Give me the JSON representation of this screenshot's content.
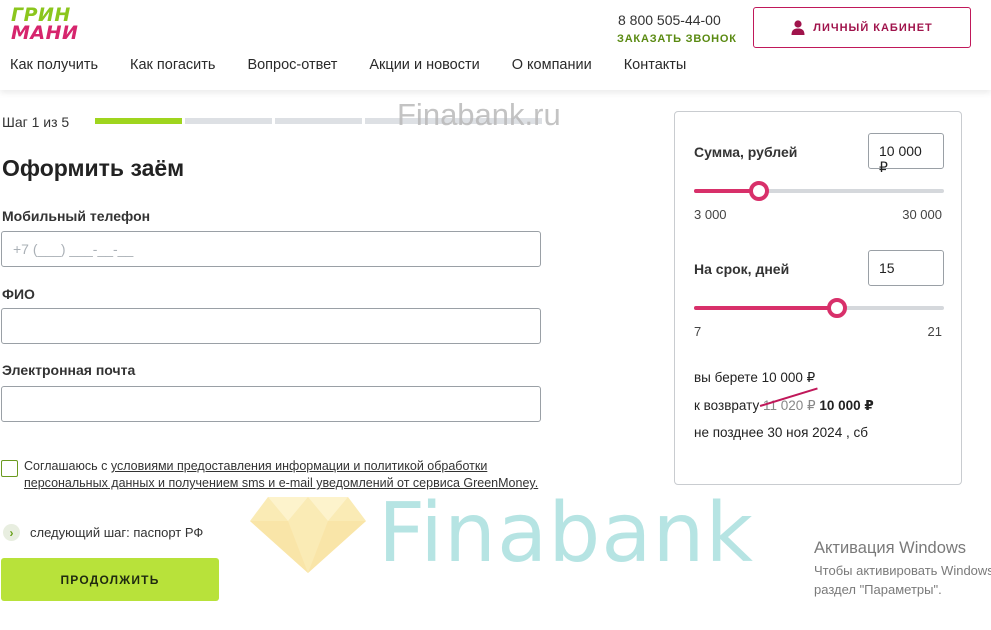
{
  "header": {
    "logo": {
      "line1": "ГРИН",
      "line2": "МАНИ",
      "color_green": "#8bc61d",
      "color_pink": "#d6256d"
    },
    "phone": "8 800 505-44-00",
    "callback_label": "ЗАКАЗАТЬ ЗВОНОК",
    "cabinet_label": "ЛИЧНЫЙ КАБИНЕТ",
    "cabinet_icon": "user-icon",
    "nav": [
      "Как получить",
      "Как погасить",
      "Вопрос-ответ",
      "Акции и новости",
      "О компании",
      "Контакты"
    ]
  },
  "steps": {
    "label": "Шаг 1 из 5",
    "current": 1,
    "total": 5,
    "accent": "#9fd51e"
  },
  "watermark": "Finabank.ru",
  "form": {
    "title": "Оформить заём",
    "phone": {
      "label": "Мобильный телефон",
      "placeholder": "+7 (___) ___-__-__",
      "value": ""
    },
    "fio": {
      "label": "ФИО",
      "value": ""
    },
    "email": {
      "label": "Электронная почта",
      "value": ""
    },
    "consent": {
      "checked": false,
      "prefix": "Соглашаюсь с ",
      "link": "условиями предоставления информации и политикой обработки персональных данных и получением sms и e-mail уведомлений от сервиса GreenMoney."
    },
    "next_step": "следующий шаг: паспорт РФ",
    "continue_label": "ПРОДОЛЖИТЬ"
  },
  "calculator": {
    "amount": {
      "label": "Сумма, рублей",
      "value": "10 000 ₽",
      "min": "3 000",
      "max": "30 000",
      "fraction": 0.26
    },
    "term": {
      "label": "На срок, дней",
      "value": "15",
      "min": "7",
      "max": "21",
      "fraction": 0.57
    },
    "summary": {
      "take": "вы берете 10 000 ₽",
      "return_prefix": "к возврату",
      "return_old": "11 020 ₽",
      "return_new": "10 000 ₽",
      "deadline": "не позднее 30 ноя 2024 , сб"
    },
    "accent": "#d8306a"
  },
  "overlay": {
    "big_watermark": "Finabank",
    "activation_title": "Активация Windows",
    "activation_line1": "Чтобы активировать Windows, перейдите в",
    "activation_line2": "раздел \"Параметры\"."
  }
}
